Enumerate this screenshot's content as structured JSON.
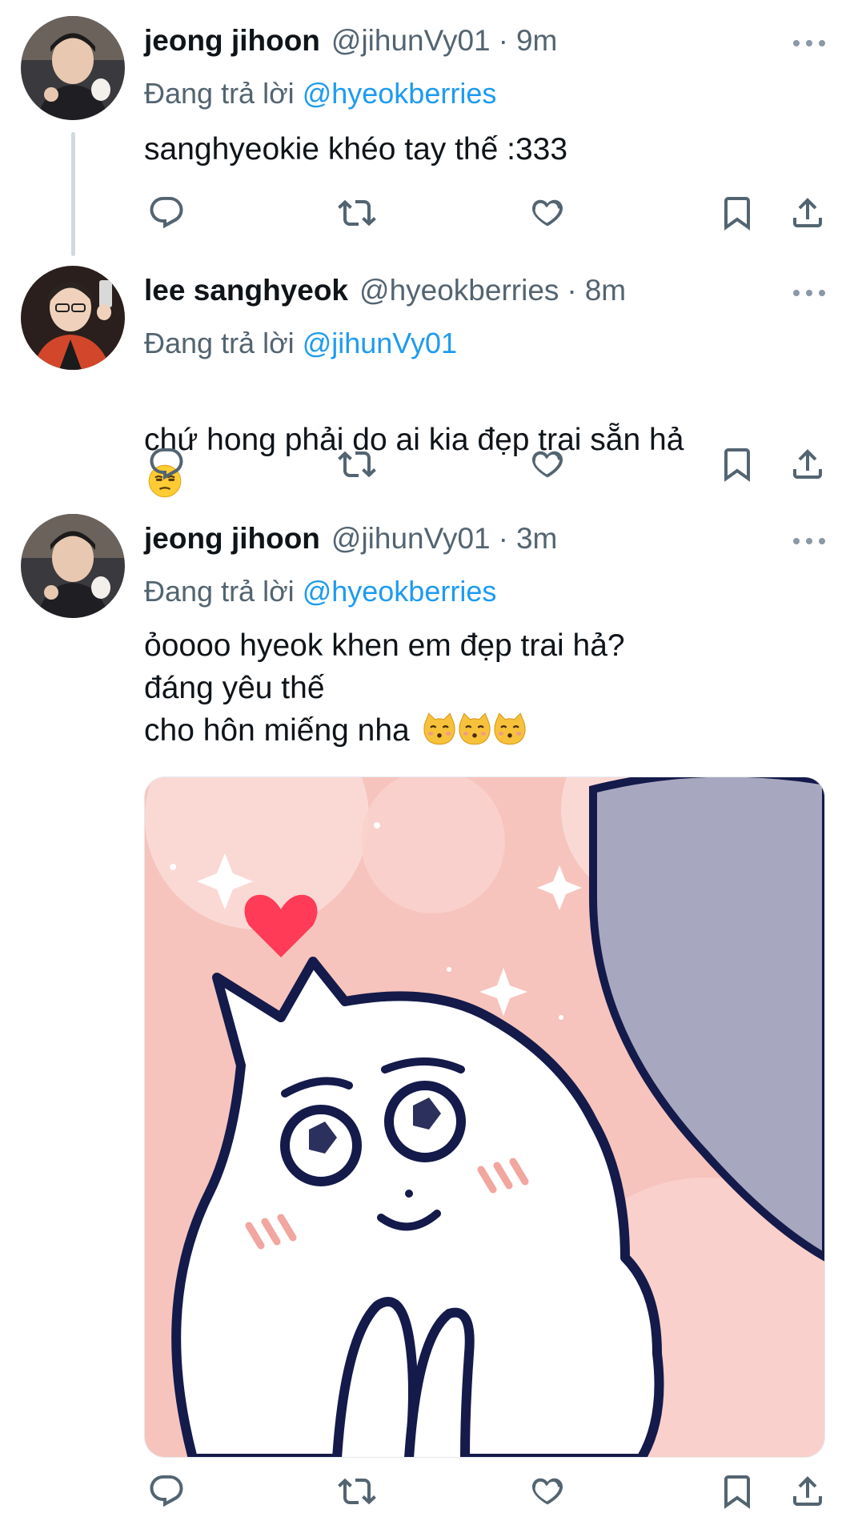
{
  "tweets": [
    {
      "name": "jeong jihoon",
      "handle": "@jihunVy01",
      "dot": "·",
      "time": "9m",
      "reply_prefix": "Đang trả lời ",
      "reply_to": "@hyeokberries",
      "text": "sanghyeokie khéo tay thế :333"
    },
    {
      "name": "lee sanghyeok",
      "handle": "@hyeokberries",
      "dot": "·",
      "time": "8m",
      "reply_prefix": "Đang trả lời ",
      "reply_to": "@jihunVy01",
      "text": "chứ hong phải do ai kia đẹp trai sẵn hả"
    },
    {
      "name": "jeong jihoon",
      "handle": "@jihunVy01",
      "dot": "·",
      "time": "3m",
      "reply_prefix": "Đang trả lời ",
      "reply_to": "@hyeokberries",
      "text_lines": [
        "ỏoooo hyeok khen em đẹp trai hả?",
        "đáng yêu thế",
        "cho hôn miếng nha"
      ]
    }
  ],
  "icons": {
    "reply": "reply-icon",
    "retweet": "retweet-icon",
    "like": "heart-icon",
    "bookmark": "bookmark-icon",
    "share": "share-icon",
    "more": "more-icon"
  },
  "colors": {
    "text": "#0f1419",
    "secondary": "#536471",
    "link": "#1d9bf0",
    "thread_line": "#cfd9de"
  }
}
